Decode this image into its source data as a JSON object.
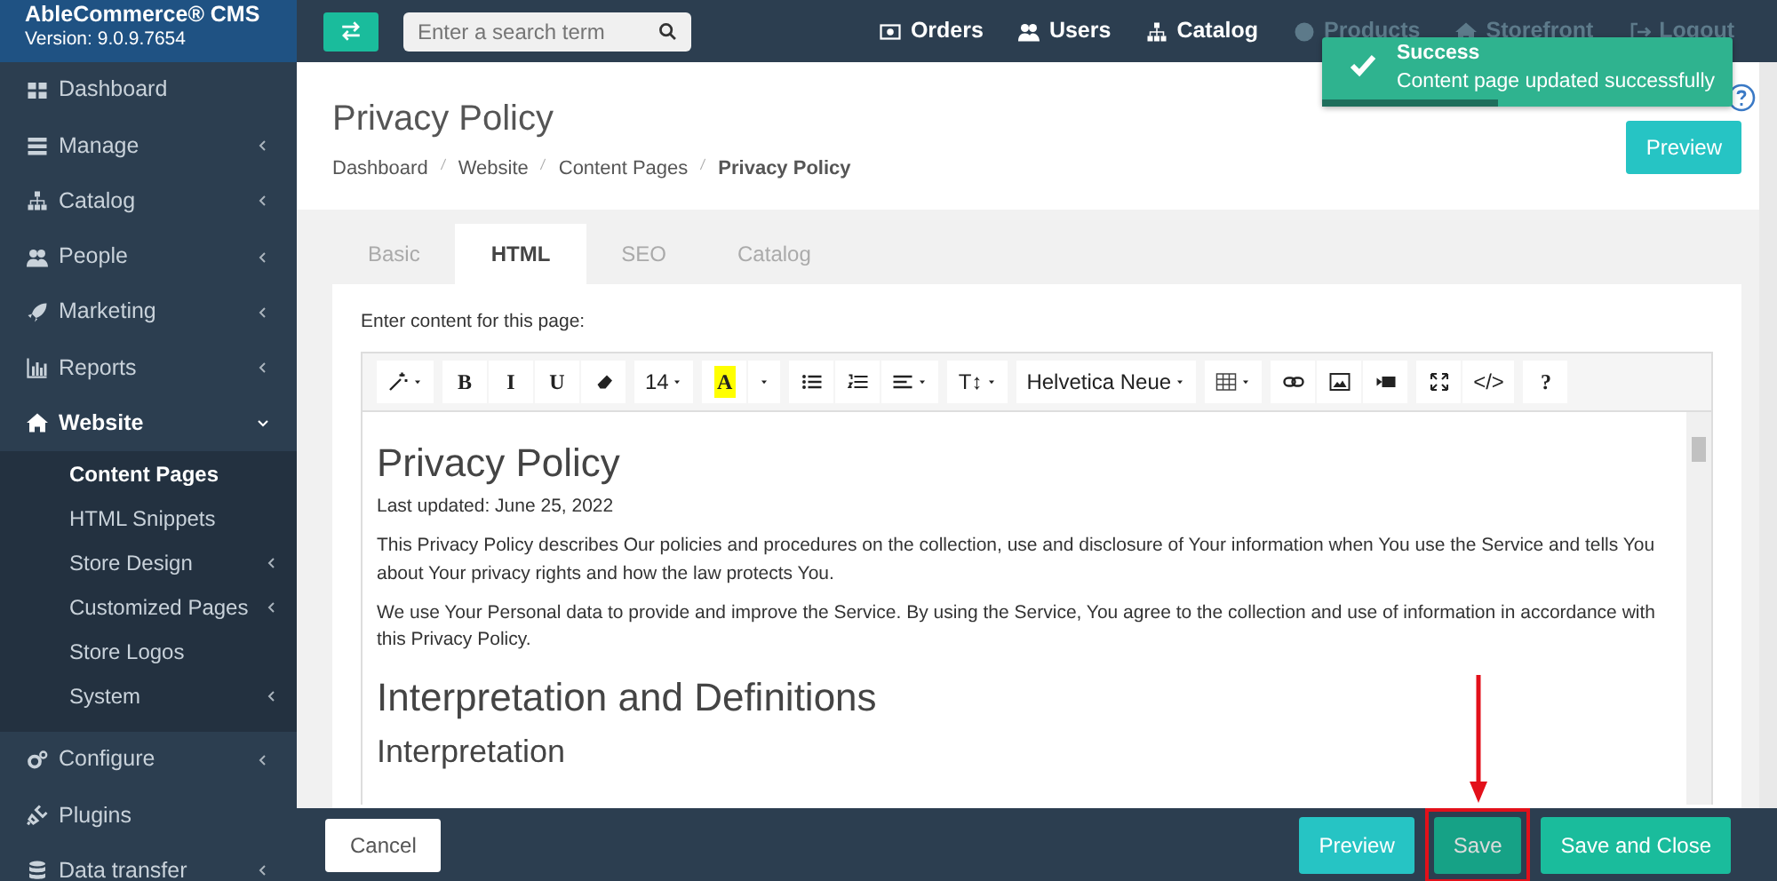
{
  "brand": {
    "title": "AbleCommerce® CMS",
    "version": "Version: 9.0.9.7654"
  },
  "sidebar": {
    "items": [
      {
        "label": "Dashboard",
        "has_submenu": false,
        "expanded": false
      },
      {
        "label": "Manage",
        "has_submenu": true,
        "expanded": false
      },
      {
        "label": "Catalog",
        "has_submenu": true,
        "expanded": false
      },
      {
        "label": "People",
        "has_submenu": true,
        "expanded": false
      },
      {
        "label": "Marketing",
        "has_submenu": true,
        "expanded": false
      },
      {
        "label": "Reports",
        "has_submenu": true,
        "expanded": false
      },
      {
        "label": "Website",
        "has_submenu": true,
        "expanded": true,
        "children": [
          {
            "label": "Content Pages",
            "has_submenu": false,
            "selected": true
          },
          {
            "label": "HTML Snippets",
            "has_submenu": false,
            "selected": false
          },
          {
            "label": "Store Design",
            "has_submenu": true,
            "selected": false
          },
          {
            "label": "Customized Pages",
            "has_submenu": true,
            "selected": false
          },
          {
            "label": "Store Logos",
            "has_submenu": false,
            "selected": false
          },
          {
            "label": "System",
            "has_submenu": true,
            "selected": false
          }
        ]
      },
      {
        "label": "Configure",
        "has_submenu": true,
        "expanded": false
      },
      {
        "label": "Plugins",
        "has_submenu": false,
        "expanded": false
      },
      {
        "label": "Data transfer",
        "has_submenu": true,
        "expanded": false
      }
    ]
  },
  "topbar": {
    "search": {
      "placeholder": "Enter a search term"
    },
    "links": [
      {
        "label": "Orders",
        "dimmed": false
      },
      {
        "label": "Users",
        "dimmed": false
      },
      {
        "label": "Catalog",
        "dimmed": false
      },
      {
        "label": "Products",
        "dimmed": true
      },
      {
        "label": "Storefront",
        "dimmed": true
      },
      {
        "label": "Logout",
        "dimmed": true
      }
    ]
  },
  "toast": {
    "title": "Success",
    "message": "Content page updated successfully",
    "level": 0.43
  },
  "header": {
    "title": "Privacy Policy",
    "breadcrumb": [
      "Dashboard",
      "Website",
      "Content Pages",
      "Privacy Policy"
    ],
    "preview_button": "Preview"
  },
  "tabs": [
    {
      "label": "Basic",
      "selected": false
    },
    {
      "label": "HTML",
      "selected": true
    },
    {
      "label": "SEO",
      "selected": false
    },
    {
      "label": "Catalog",
      "selected": false
    }
  ],
  "editor": {
    "label": "Enter content for this page:",
    "toolbar": [
      [
        {
          "kind": "icon",
          "dropdown": true
        }
      ],
      [
        {
          "kind": "text",
          "label": "B"
        },
        {
          "kind": "text",
          "label": "I"
        },
        {
          "kind": "text",
          "label": "U"
        },
        {
          "kind": "icon",
          "dropdown": false
        }
      ],
      [
        {
          "kind": "text",
          "label": "14",
          "dropdown": true
        }
      ],
      [
        {
          "kind": "highlight",
          "label": "A"
        },
        {
          "kind": "caret"
        }
      ],
      [
        {
          "kind": "icon",
          "dropdown": false
        },
        {
          "kind": "icon",
          "dropdown": false
        },
        {
          "kind": "icon",
          "dropdown": true
        }
      ],
      [
        {
          "kind": "text",
          "label": "T↕",
          "dropdown": true
        }
      ],
      [
        {
          "kind": "text",
          "label": "Helvetica Neue",
          "dropdown": true
        }
      ],
      [
        {
          "kind": "icon",
          "dropdown": true
        }
      ],
      [
        {
          "kind": "icon",
          "dropdown": false
        },
        {
          "kind": "icon",
          "dropdown": false
        },
        {
          "kind": "icon",
          "dropdown": false
        }
      ],
      [
        {
          "kind": "icon",
          "dropdown": false
        },
        {
          "kind": "text",
          "label": "</>",
          "dropdown": false
        }
      ],
      [
        {
          "kind": "text",
          "label": "?",
          "dropdown": false
        }
      ]
    ],
    "document": [
      {
        "kind": "h1",
        "text": "Privacy Policy"
      },
      {
        "kind": "p",
        "text": "Last updated: June 25, 2022"
      },
      {
        "kind": "p",
        "text": "This Privacy Policy describes Our policies and procedures on the collection, use and disclosure of Your information when You use the Service and tells You about Your privacy rights and how the law protects You."
      },
      {
        "kind": "p",
        "text": "We use Your Personal data to provide and improve the Service. By using the Service, You agree to the collection and use of information in accordance with this Privacy Policy."
      },
      {
        "kind": "h2",
        "text": "Interpretation and Definitions"
      },
      {
        "kind": "h3",
        "text": "Interpretation"
      }
    ]
  },
  "footer": {
    "cancel": "Cancel",
    "buttons": [
      {
        "label": "Preview",
        "kind": "info",
        "highlighted": false
      },
      {
        "label": "Save",
        "kind": "primary",
        "highlighted": true
      },
      {
        "label": "Save and Close",
        "kind": "primary",
        "highlighted": false
      }
    ]
  }
}
